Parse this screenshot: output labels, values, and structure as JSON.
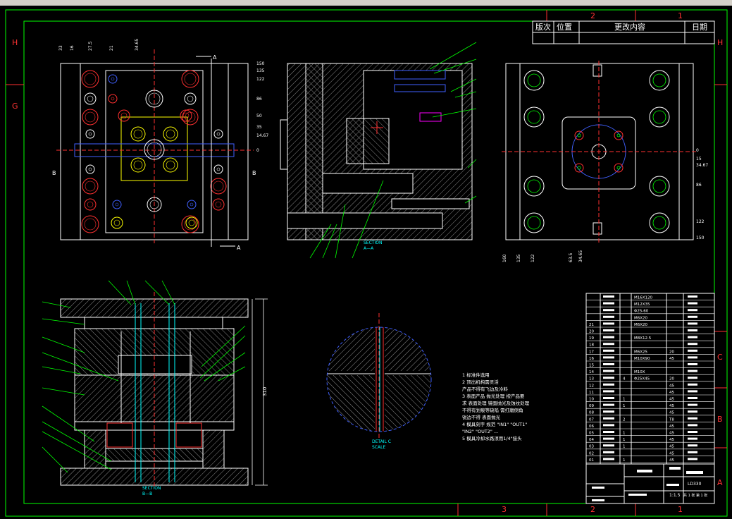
{
  "border_zones": {
    "top": [
      "2",
      "1"
    ],
    "bottom": [
      "3",
      "2",
      "1"
    ],
    "left": [
      "H",
      "G"
    ],
    "right": [
      "H",
      "C",
      "B",
      "A"
    ]
  },
  "revision_table": {
    "headers": [
      "版次",
      "位置",
      "更改内容",
      "日期"
    ]
  },
  "labels": {
    "section_a_mark_top": "A",
    "section_a_mark_bottom": "A",
    "section_b_mark_left": "B",
    "section_b_mark_right": "B",
    "section_aa_title": "SECTION",
    "section_aa_sub": "A—A",
    "section_bb_title": "SECTION",
    "section_bb_sub": "B—B",
    "detail_title": "DETAIL C",
    "detail_scale": "SCALE"
  },
  "notes": [
    "1 标准件选用",
    "2 顶出机构需灵活",
    "  产品不得有飞边及冷料",
    "3 表面产品    抛光处理 按产品要",
    "  求 表面处理 镜面抛光及蚀纹处理",
    "  不得有划痕等缺陷  需打磨倒角",
    "  锐边不得  表面抛光",
    "4 模具刻字 规范 \"IN1\" \"OUT1\"",
    "  \"IN2\" \"OUT2\" ...",
    "5 模具冷却水路须用1/4\"接头"
  ],
  "dim_labels_plan": [
    "33",
    "16",
    "27.5",
    "21",
    "34.65",
    "150",
    "135",
    "122",
    "86",
    "50",
    "35",
    "14.67",
    "0"
  ],
  "dim_labels_side": [
    "0",
    "15",
    "34.67",
    "86",
    "122",
    "150"
  ],
  "dim_labels_side_bottom": [
    "160",
    "135",
    "122",
    "63.5",
    "34.65"
  ],
  "dim_total_height": "310",
  "bom_rows": [
    {
      "no": "",
      "qty": "",
      "name": "M16X120",
      "mat": ""
    },
    {
      "no": "",
      "qty": "",
      "name": "M12X35",
      "mat": ""
    },
    {
      "no": "",
      "qty": "",
      "name": "Φ25-60",
      "mat": ""
    },
    {
      "no": "",
      "qty": "",
      "name": "M6X20",
      "mat": ""
    },
    {
      "no": "21",
      "qty": "",
      "name": "M6X20",
      "mat": ""
    },
    {
      "no": "20",
      "qty": "",
      "name": "",
      "mat": ""
    },
    {
      "no": "19",
      "qty": "",
      "name": "M8X12.5",
      "mat": ""
    },
    {
      "no": "18",
      "qty": "",
      "name": "",
      "mat": ""
    },
    {
      "no": "17",
      "qty": "",
      "name": "M6X25",
      "mat": "20"
    },
    {
      "no": "16",
      "qty": "",
      "name": "M10X90",
      "mat": "45"
    },
    {
      "no": "15",
      "qty": "",
      "name": "",
      "mat": ""
    },
    {
      "no": "14",
      "qty": "",
      "name": "M10X",
      "mat": ""
    },
    {
      "no": "13",
      "qty": "4",
      "name": "Φ25X45",
      "mat": "20"
    },
    {
      "no": "12",
      "qty": "",
      "name": "",
      "mat": "45"
    },
    {
      "no": "11",
      "qty": "",
      "name": "",
      "mat": "45"
    },
    {
      "no": "10",
      "qty": "1",
      "name": "",
      "mat": "45"
    },
    {
      "no": "09",
      "qty": "1",
      "name": "",
      "mat": "45"
    },
    {
      "no": "08",
      "qty": "",
      "name": "",
      "mat": "45"
    },
    {
      "no": "07",
      "qty": "2",
      "name": "",
      "mat": "T8"
    },
    {
      "no": "06",
      "qty": "",
      "name": "",
      "mat": "45"
    },
    {
      "no": "05",
      "qty": "1",
      "name": "",
      "mat": "45"
    },
    {
      "no": "04",
      "qty": "1",
      "name": "",
      "mat": "45"
    },
    {
      "no": "03",
      "qty": "1",
      "name": "",
      "mat": "45"
    },
    {
      "no": "02",
      "qty": "",
      "name": "",
      "mat": "45"
    },
    {
      "no": "01",
      "qty": "1",
      "name": "",
      "mat": "45"
    }
  ],
  "title_block": {
    "drawing_no": "LD330",
    "scale": "1:1.5",
    "sheet": "共 1 张 第 1 张"
  },
  "colors": {
    "frame": "#00ff00",
    "outline": "#ffffff",
    "hatch": "#9a9a9a",
    "cyan": "#00ffff",
    "red": "#ff3030",
    "yellow": "#ffff00",
    "magenta": "#ff00ff",
    "blue": "#4060ff"
  }
}
